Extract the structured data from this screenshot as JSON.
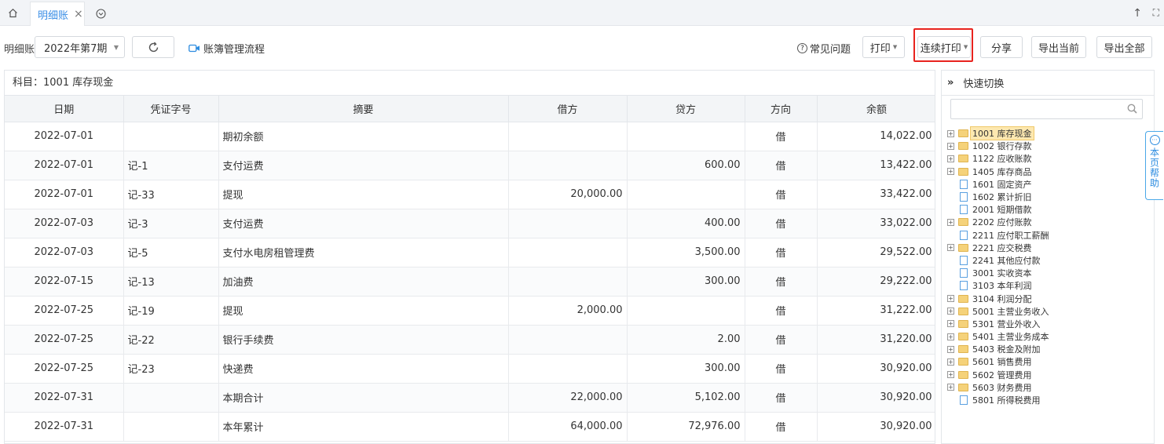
{
  "tabs": {
    "active_label": "明细账",
    "close_glyph": "×"
  },
  "toolbar": {
    "label": "明细账",
    "period": "2022年第7期",
    "flow_link": "账簿管理流程",
    "faq": "常见问题",
    "print": "打印",
    "continuous_print": "连续打印",
    "share": "分享",
    "export_current": "导出当前",
    "export_all": "导出全部"
  },
  "subject": "科目：1001 库存现金",
  "table": {
    "headers": [
      "日期",
      "凭证字号",
      "摘要",
      "借方",
      "贷方",
      "方向",
      "余额"
    ],
    "rows": [
      [
        "2022-07-01",
        "",
        "期初余额",
        "",
        "",
        "借",
        "14,022.00"
      ],
      [
        "2022-07-01",
        "记-1",
        "支付运费",
        "",
        "600.00",
        "借",
        "13,422.00"
      ],
      [
        "2022-07-01",
        "记-33",
        "提现",
        "20,000.00",
        "",
        "借",
        "33,422.00"
      ],
      [
        "2022-07-03",
        "记-3",
        "支付运费",
        "",
        "400.00",
        "借",
        "33,022.00"
      ],
      [
        "2022-07-03",
        "记-5",
        "支付水电房租管理费",
        "",
        "3,500.00",
        "借",
        "29,522.00"
      ],
      [
        "2022-07-15",
        "记-13",
        "加油费",
        "",
        "300.00",
        "借",
        "29,222.00"
      ],
      [
        "2022-07-25",
        "记-19",
        "提现",
        "2,000.00",
        "",
        "借",
        "31,222.00"
      ],
      [
        "2022-07-25",
        "记-22",
        "银行手续费",
        "",
        "2.00",
        "借",
        "31,220.00"
      ],
      [
        "2022-07-25",
        "记-23",
        "快递费",
        "",
        "300.00",
        "借",
        "30,920.00"
      ],
      [
        "2022-07-31",
        "",
        "本期合计",
        "22,000.00",
        "5,102.00",
        "借",
        "30,920.00"
      ],
      [
        "2022-07-31",
        "",
        "本年累计",
        "64,000.00",
        "72,976.00",
        "借",
        "30,920.00"
      ]
    ]
  },
  "side": {
    "title": "快速切换",
    "search_placeholder": "",
    "items": [
      {
        "label": "1001 库存现金",
        "kind": "folder",
        "selected": true
      },
      {
        "label": "1002 银行存款",
        "kind": "folder"
      },
      {
        "label": "1122 应收账款",
        "kind": "folder"
      },
      {
        "label": "1405 库存商品",
        "kind": "folder"
      },
      {
        "label": "1601 固定资产",
        "kind": "file"
      },
      {
        "label": "1602 累计折旧",
        "kind": "file"
      },
      {
        "label": "2001 短期借款",
        "kind": "file"
      },
      {
        "label": "2202 应付账款",
        "kind": "folder"
      },
      {
        "label": "2211 应付职工薪酬",
        "kind": "file"
      },
      {
        "label": "2221 应交税费",
        "kind": "folder"
      },
      {
        "label": "2241 其他应付款",
        "kind": "file"
      },
      {
        "label": "3001 实收资本",
        "kind": "file"
      },
      {
        "label": "3103 本年利润",
        "kind": "file"
      },
      {
        "label": "3104 利润分配",
        "kind": "folder"
      },
      {
        "label": "5001 主营业务收入",
        "kind": "folder"
      },
      {
        "label": "5301 营业外收入",
        "kind": "folder"
      },
      {
        "label": "5401 主营业务成本",
        "kind": "folder"
      },
      {
        "label": "5403 税金及附加",
        "kind": "folder"
      },
      {
        "label": "5601 销售费用",
        "kind": "folder"
      },
      {
        "label": "5602 管理费用",
        "kind": "folder"
      },
      {
        "label": "5603 财务费用",
        "kind": "folder"
      },
      {
        "label": "5801 所得税费用",
        "kind": "file"
      }
    ]
  },
  "help": {
    "label": "本页帮助"
  },
  "colors": {
    "accent": "#3a8ee6",
    "highlight_border": "#e8231e",
    "selected_bg": "#fde8b0"
  }
}
